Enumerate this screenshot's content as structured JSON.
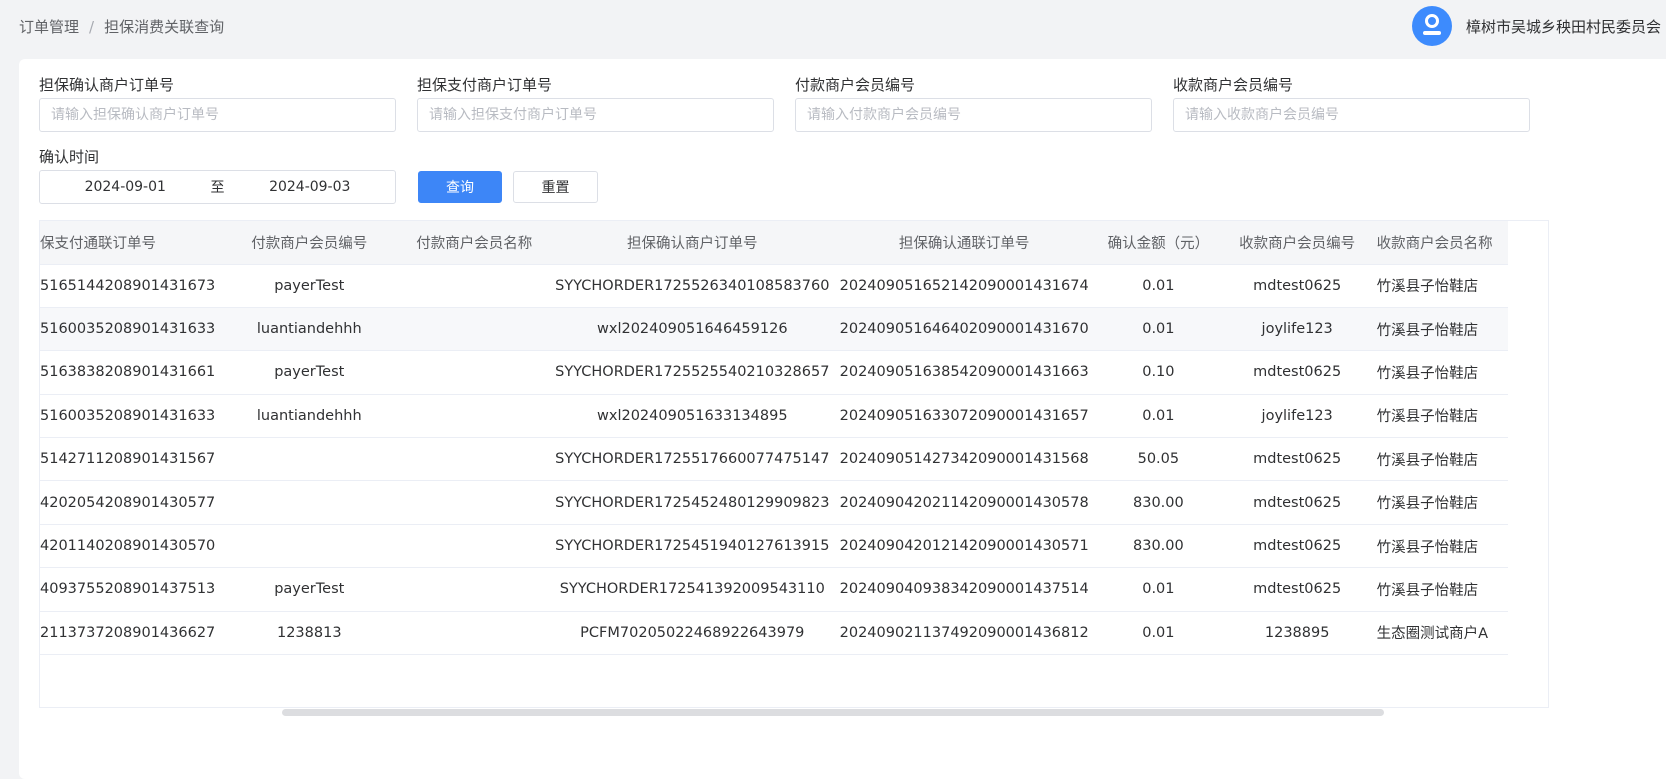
{
  "breadcrumb": {
    "parent": "订单管理",
    "separator": "/",
    "current": "担保消费关联查询"
  },
  "user": {
    "avatar_icon": "user-avatar-icon",
    "name": "樟树市吴城乡秧田村民委员会"
  },
  "filters": {
    "confirm_order": {
      "label": "担保确认商户订单号",
      "placeholder": "请输入担保确认商户订单号",
      "value": ""
    },
    "pay_order": {
      "label": "担保支付商户订单号",
      "placeholder": "请输入担保支付商户订单号",
      "value": ""
    },
    "payer_no": {
      "label": "付款商户会员编号",
      "placeholder": "请输入付款商户会员编号",
      "value": ""
    },
    "payee_no": {
      "label": "收款商户会员编号",
      "placeholder": "请输入收款商户会员编号",
      "value": ""
    },
    "confirm_time": {
      "label": "确认时间",
      "start": "2024-09-01",
      "to": "至",
      "end": "2024-09-03"
    }
  },
  "buttons": {
    "query": "查询",
    "reset": "重置"
  },
  "table": {
    "columns": [
      "保支付通联订单号",
      "付款商户会员编号",
      "付款商户会员名称",
      "担保确认商户订单号",
      "担保确认通联订单号",
      "确认金额（元）",
      "收款商户会员编号",
      "收款商户会员名称"
    ],
    "rows": [
      [
        "5165144208901431673",
        "payerTest",
        "",
        "SYYCHORDER1725526340108583760",
        "202409051652142090001431674",
        "0.01",
        "mdtest0625",
        "竹溪县子怡鞋店"
      ],
      [
        "5160035208901431633",
        "luantiandehhh",
        "",
        "wxl202409051646459126",
        "202409051646402090001431670",
        "0.01",
        "joylife123",
        "竹溪县子怡鞋店"
      ],
      [
        "5163838208901431661",
        "payerTest",
        "",
        "SYYCHORDER1725525540210328657",
        "202409051638542090001431663",
        "0.10",
        "mdtest0625",
        "竹溪县子怡鞋店"
      ],
      [
        "5160035208901431633",
        "luantiandehhh",
        "",
        "wxl202409051633134895",
        "202409051633072090001431657",
        "0.01",
        "joylife123",
        "竹溪县子怡鞋店"
      ],
      [
        "5142711208901431567",
        "",
        "",
        "SYYCHORDER1725517660077475147",
        "202409051427342090001431568",
        "50.05",
        "mdtest0625",
        "竹溪县子怡鞋店"
      ],
      [
        "4202054208901430577",
        "",
        "",
        "SYYCHORDER1725452480129909823",
        "202409042021142090001430578",
        "830.00",
        "mdtest0625",
        "竹溪县子怡鞋店"
      ],
      [
        "4201140208901430570",
        "",
        "",
        "SYYCHORDER1725451940127613915",
        "202409042012142090001430571",
        "830.00",
        "mdtest0625",
        "竹溪县子怡鞋店"
      ],
      [
        "4093755208901437513",
        "payerTest",
        "",
        "SYYCHORDER172541392009543110",
        "202409040938342090001437514",
        "0.01",
        "mdtest0625",
        "竹溪县子怡鞋店"
      ],
      [
        "2113737208901436627",
        "1238813",
        "",
        "PCFM70205022468922643979",
        "202409021137492090001436812",
        "0.01",
        "1238895",
        "生态圈测试商户A"
      ]
    ]
  }
}
